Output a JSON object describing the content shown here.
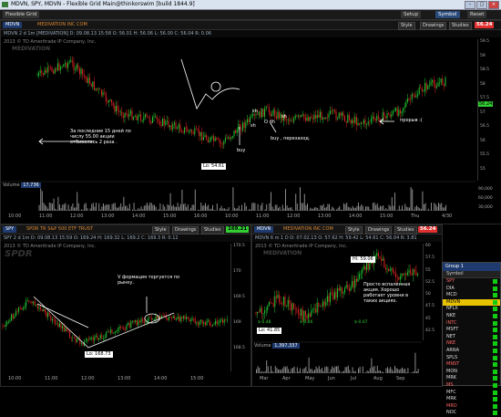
{
  "window": {
    "title": "MDVN, SPY, MDVN - Flexible Grid Main@thinkorswim [build 1844.9]"
  },
  "topbar": {
    "grid_label": "Flexible Grid",
    "buttons": [
      "Setup",
      "Symbol",
      "Reset"
    ]
  },
  "main": {
    "symbol": "MDVN",
    "source": "MEDIVATION INC COM",
    "price": "56.24",
    "subtitle": "MDVN 2 d 1m [MEDIVATION]  D: 09.08.13 15:58  O: 56.01  H: 56.06  L: 56.00  C: 56.04  R: 0.06",
    "copyright": "2013 © TD Ameritrade IP Company, Inc.",
    "watermark": "MEDIVATION",
    "buttons": [
      "Style",
      "Drawings",
      "Studies"
    ],
    "price_axis": [
      "59.5",
      "59",
      "58.5",
      "58",
      "57.5",
      "57",
      "56.5",
      "56",
      "55.5",
      "55"
    ],
    "right_price_tag": "56.24",
    "time_axis": [
      "10:00",
      "11:00",
      "12:00",
      "13:00",
      "14:00",
      "15:00",
      "16:00",
      "10:00",
      "11:00",
      "12:00",
      "13:00",
      "14:00",
      "15:00",
      "Thu",
      "4/30"
    ],
    "volume_label": "Volume",
    "volume_value": "17,736",
    "volume_axis": [
      "90,000",
      "60,000",
      "30,000"
    ],
    "annotations": {
      "left_note": "За последние 15 дней по числу 55.00 акции отбивалась 2 раза .",
      "low_label": "Lo: 54.61",
      "buy": "buy",
      "buy_retest": "buy , перезаход.",
      "sh1": "sh",
      "sh2": "sh",
      "sh3": "sh",
      "dlh": "O dh",
      "breakout": "прорыв :("
    }
  },
  "spy": {
    "symbol": "SPY",
    "source": "SPDR TR S&P 500 ETF TRUST",
    "price": "169.21",
    "subtitle": "SPY 2 d 1m  D: 09.08.13 15:59  O: 169.24  H: 169.32  L: 169.2  C: 169.3  R: 0.12",
    "copyright": "2013 © TD Ameritrade IP Company, Inc.",
    "watermark": "SPDR",
    "buttons": [
      "Style",
      "Drawings",
      "Studies"
    ],
    "price_axis": [
      "170.5",
      "170",
      "169.5",
      "169",
      "168.5"
    ],
    "time_axis": [
      "10:00",
      "11:00",
      "12:00",
      "13:00",
      "14:00",
      "15:00"
    ],
    "low_label": "Lo: 168.73",
    "note": "V формация торгуется по рынку."
  },
  "mdvn2": {
    "symbol": "MDVN",
    "source": "MEDIVATION INC COM",
    "price": "56.24",
    "subtitle": "MDVN 6 m 1 D  D: 07.02.13  O: 57.62  H: 59.42  L: 54.61  C: 56.04  R: 3.81",
    "copyright": "2013 © TD Ameritrade IP Company, Inc.",
    "watermark": "MEDIVATION",
    "buttons": [
      "Style",
      "Drawings",
      "Studies"
    ],
    "price_axis": [
      "60",
      "57.5",
      "55",
      "52.5",
      "50",
      "47.5",
      "45",
      "42.5"
    ],
    "time_axis": [
      "Mar",
      "Apr",
      "May",
      "Jun",
      "Jul",
      "Aug",
      "Sep"
    ],
    "hi_label": "Hi: 59.06",
    "lo_label": "Lo: 41.85",
    "note": "Просто вспаленная акция. Хорошо работает уровни в таких акциях.",
    "volume_label": "Volume",
    "volume_value": "1,397,337",
    "events": [
      "$-0.48",
      "$-0.26",
      "$-0.07"
    ]
  },
  "watchlist": {
    "title": "Group 1",
    "header": "Symbol",
    "items": [
      "SPY",
      "DIA",
      "MCD",
      "MDVN",
      "NFLX",
      "NKE",
      "INTC",
      "MSFT",
      "NET",
      "NKE",
      "ARNA",
      "SPLS",
      "MNST",
      "MON",
      "MRK",
      "MS",
      "MFC",
      "MRK",
      "MRO",
      "NOC"
    ],
    "selected": "MDVN"
  },
  "colors": {
    "up": "#22cc33",
    "down": "#dd2222",
    "accent": "#1e3a6e",
    "price_tag": "#33cc33"
  }
}
